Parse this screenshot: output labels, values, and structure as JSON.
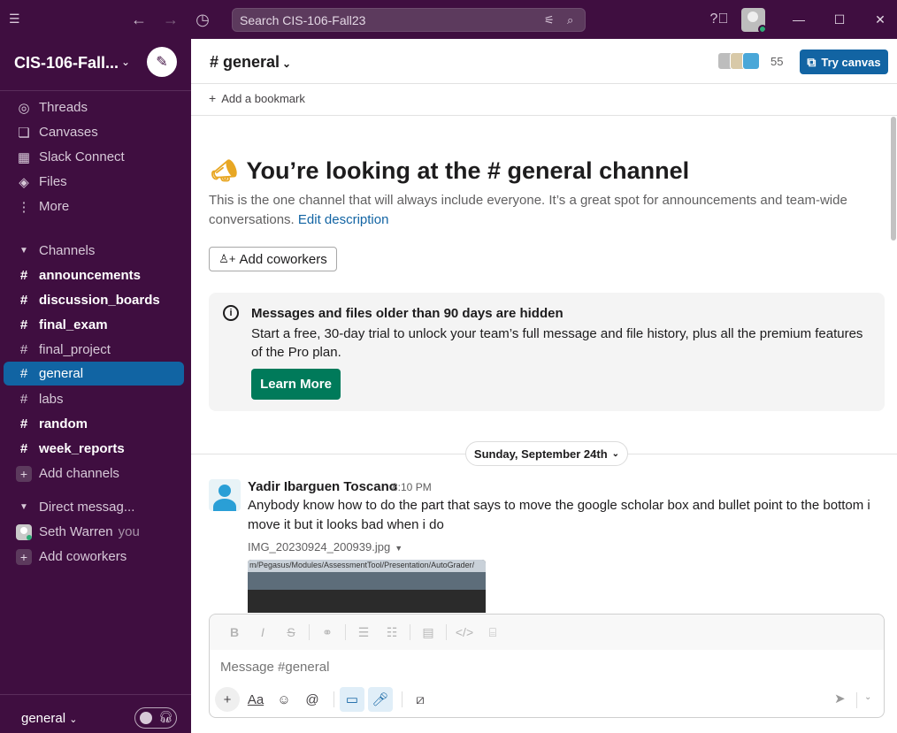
{
  "topbar": {
    "search_placeholder": "Search CIS-106-Fall23"
  },
  "workspace": {
    "name": "CIS-106-Fall..."
  },
  "sidebar": {
    "nav": [
      {
        "label": "Threads",
        "icon": "threads-icon"
      },
      {
        "label": "Canvases",
        "icon": "canvases-icon"
      },
      {
        "label": "Slack Connect",
        "icon": "slack-connect-icon"
      },
      {
        "label": "Files",
        "icon": "files-icon"
      },
      {
        "label": "More",
        "icon": "more-icon"
      }
    ],
    "channels_header": "Channels",
    "channels": [
      {
        "name": "announcements",
        "unread": true
      },
      {
        "name": "discussion_boards",
        "unread": true
      },
      {
        "name": "final_exam",
        "unread": true
      },
      {
        "name": "final_project",
        "unread": false
      },
      {
        "name": "general",
        "active": true
      },
      {
        "name": "labs",
        "unread": false
      },
      {
        "name": "random",
        "unread": true
      },
      {
        "name": "week_reports",
        "unread": true
      }
    ],
    "add_channels": "Add channels",
    "dm_header": "Direct messag...",
    "dms": [
      {
        "name": "Seth Warren",
        "suffix": "you"
      }
    ],
    "add_coworkers": "Add coworkers",
    "footer_channel": "general"
  },
  "channel": {
    "title": "general",
    "member_count": "55",
    "try_canvas": "Try canvas",
    "add_bookmark": "Add a bookmark"
  },
  "intro": {
    "title_prefix": "You’re looking at the",
    "title_channel": "general channel",
    "description": "This is the one channel that will always include everyone. It’s a great spot for announcements and team-wide conversations.",
    "edit_link": "Edit description",
    "add_coworkers": "Add coworkers"
  },
  "notice": {
    "heading": "Messages and files older than 90 days are hidden",
    "body": "Start a free, 30-day trial to unlock your team’s full message and file history, plus all the premium features of the Pro plan.",
    "button": "Learn More"
  },
  "date_divider": "Sunday, September 24th",
  "message": {
    "author": "Yadir Ibarguen Toscano",
    "time": "8:10 PM",
    "text": "Anybody know how to do the part that says to move the google scholar box and bullet point to the bottom i move it but it looks bad when i do",
    "file_name": "IMG_20230924_200939.jpg",
    "thumbnail_text": "m/Pegasus/Modules/AssessmentTool/Presentation/AutoGrader/"
  },
  "composer": {
    "placeholder": "Message #general"
  }
}
